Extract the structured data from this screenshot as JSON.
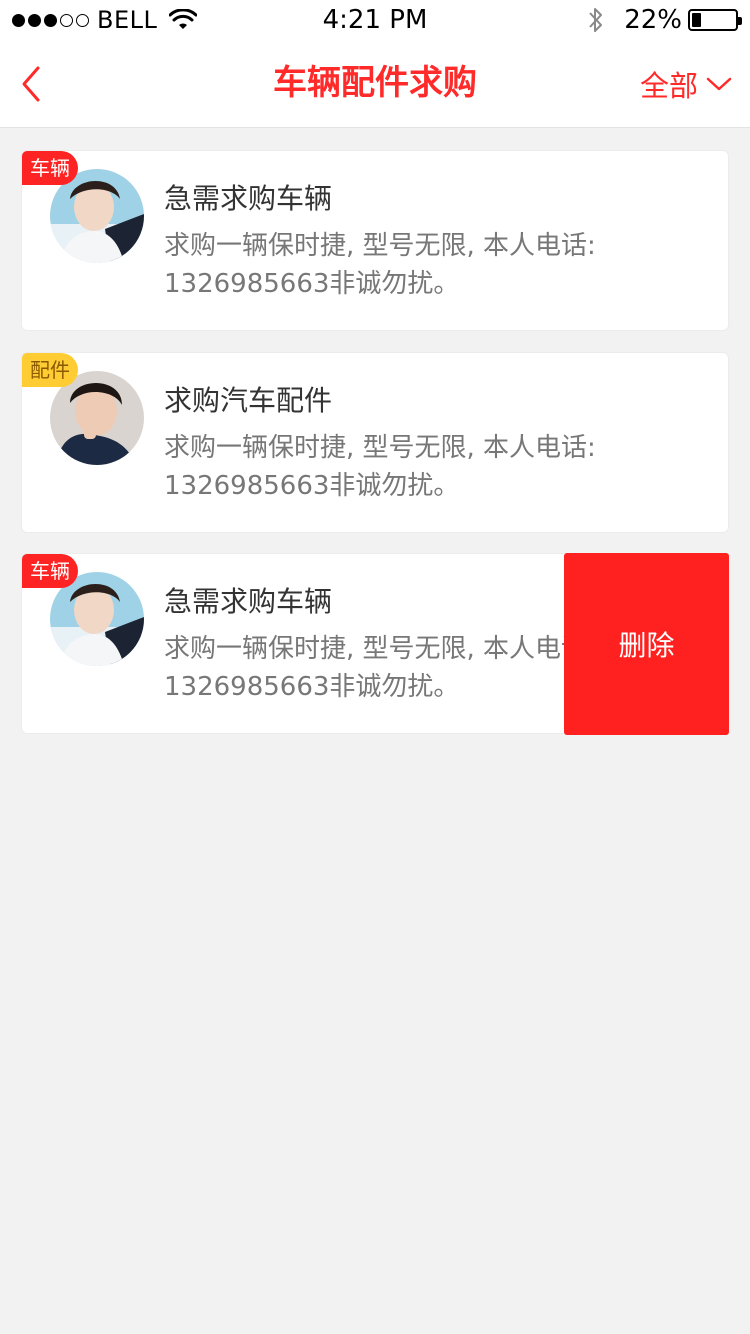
{
  "status_bar": {
    "carrier": "BELL",
    "time": "4:21 PM",
    "battery_percent": "22%",
    "battery_level": 0.22,
    "signal_bars_filled": 3,
    "signal_bars_total": 5
  },
  "nav": {
    "title": "车辆配件求购",
    "filter_label": "全部",
    "accent_color": "#ff2a2a"
  },
  "cards": [
    {
      "tag": "车辆",
      "tag_color": "#ff2424",
      "title": "急需求购车辆",
      "desc": "求购一辆保时捷, 型号无限, 本人电话: 1326985663非诚勿扰。"
    },
    {
      "tag": "配件",
      "tag_color": "#ffcc33",
      "title": "求购汽车配件",
      "desc": "求购一辆保时捷, 型号无限, 本人电话: 1326985663非诚勿扰。"
    },
    {
      "tag": "车辆",
      "tag_color": "#ff2424",
      "title": "急需求购车辆",
      "desc": "求购一辆保时捷, 型号无限, 本人电话: 1326985663非诚勿扰。"
    }
  ],
  "delete_button": {
    "label": "删除",
    "color": "#ff2020"
  },
  "icons": {
    "back": "chevron-left-icon",
    "filter": "chevron-down-icon",
    "wifi": "wifi-icon",
    "bluetooth": "bluetooth-icon",
    "battery": "battery-icon"
  }
}
